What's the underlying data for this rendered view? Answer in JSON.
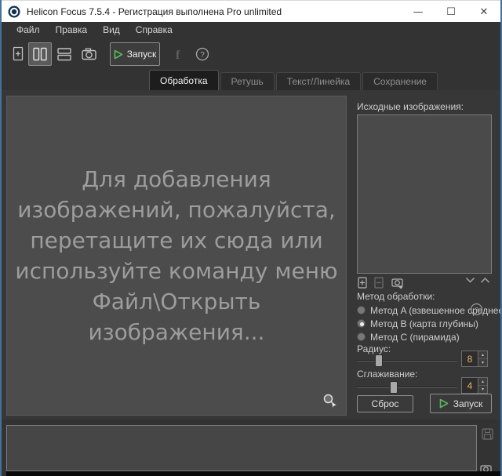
{
  "window": {
    "title": "Helicon Focus 7.5.4 - Регистрация выполнена Pro unlimited",
    "controls": {
      "minimize": "—",
      "maximize": "☐",
      "close": "✕"
    }
  },
  "menu": {
    "items": [
      {
        "label": "Файл"
      },
      {
        "label": "Правка"
      },
      {
        "label": "Вид"
      },
      {
        "label": "Справка"
      }
    ]
  },
  "toolbar": {
    "icons": [
      "add-images",
      "vertical-split-view",
      "horizontal-split-view",
      "camera",
      "facebook",
      "help"
    ],
    "run_label": "Запуск"
  },
  "tabs": {
    "items": [
      {
        "label": "Обработка",
        "active": true
      },
      {
        "label": "Ретушь",
        "active": false
      },
      {
        "label": "Текст/Линейка",
        "active": false
      },
      {
        "label": "Сохранение",
        "active": false
      }
    ]
  },
  "dropzone": {
    "message": "Для добавления\nизображений, пожалуйста,\nперетащите их сюда или\nиспользуйте команду меню\nФайл\\Открыть\nизображения..."
  },
  "source_panel": {
    "label": "Исходные изображения:",
    "list_tools": [
      "add-image",
      "remove-image",
      "camera-capture",
      "move-down",
      "move-up"
    ]
  },
  "method": {
    "label": "Метод обработки:",
    "options": [
      {
        "label": "Метод A (взвешенное среднее)",
        "selected": false
      },
      {
        "label": "Метод B (карта глубины)",
        "selected": true
      },
      {
        "label": "Метод C (пирамида)",
        "selected": false
      }
    ]
  },
  "radius": {
    "label": "Радиус:",
    "value": "8"
  },
  "smoothing": {
    "label": "Сглаживание:",
    "value": "4"
  },
  "actions": {
    "reset_label": "Сброс",
    "run_label": "Запуск"
  },
  "colors": {
    "accent_green": "#5cb85c",
    "value_orange": "#e8b36a",
    "window_border_blue": "#46719c",
    "titlebar_bg": "#ffffff",
    "panel_bg": "#373737",
    "bar_bg": "#333333"
  }
}
